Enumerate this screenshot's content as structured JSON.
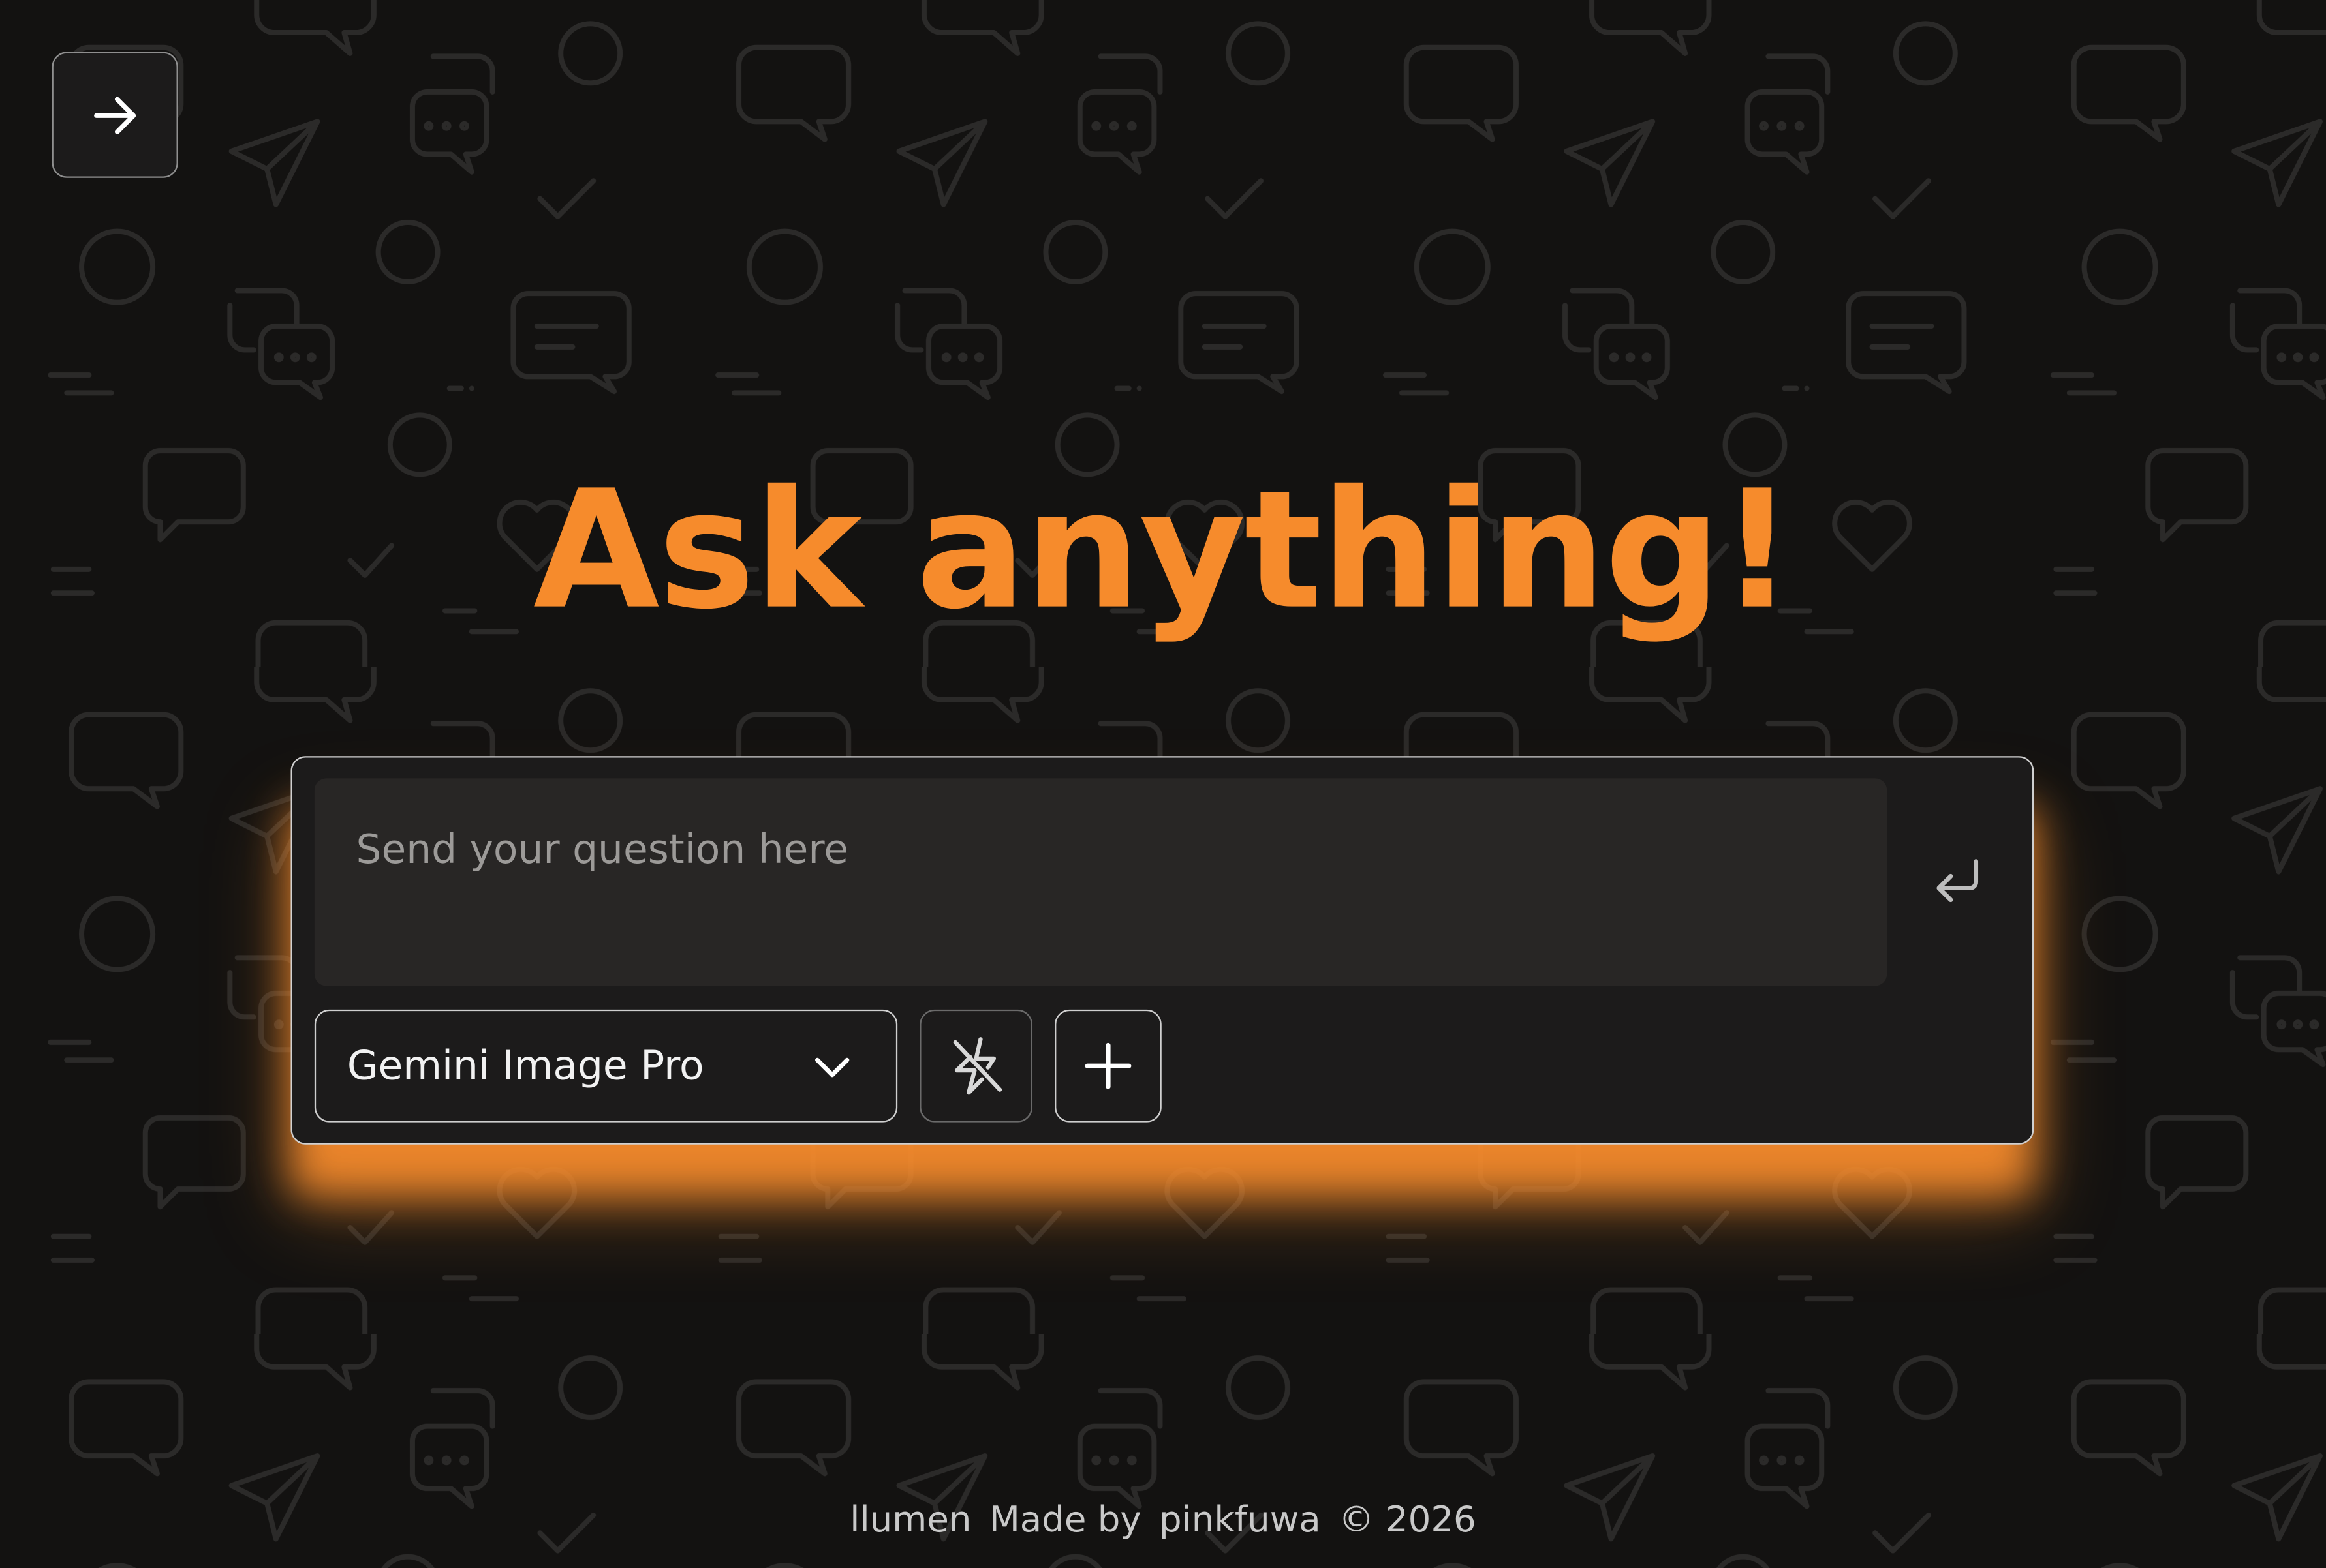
{
  "nav": {
    "icon": "arrow-right-icon"
  },
  "headline": {
    "text": "Ask anything!"
  },
  "composer": {
    "placeholder": "Send your question here",
    "value": "",
    "submit_icon": "enter-return-icon",
    "model_select": {
      "selected": "Gemini Image Pro",
      "icon": "chevron-down-icon"
    },
    "flash_toggle_icon": "flash-off-icon",
    "add_icon": "plus-icon"
  },
  "footer": {
    "brand": "llumen",
    "made_by": "Made by",
    "author": "pinkfuwa",
    "copyright": "© 2026"
  },
  "colors": {
    "accent": "#f68b2c",
    "background": "#131211",
    "panel": "#1c1b1b",
    "input": "#282625",
    "pattern_stroke": "#2b2a29"
  }
}
